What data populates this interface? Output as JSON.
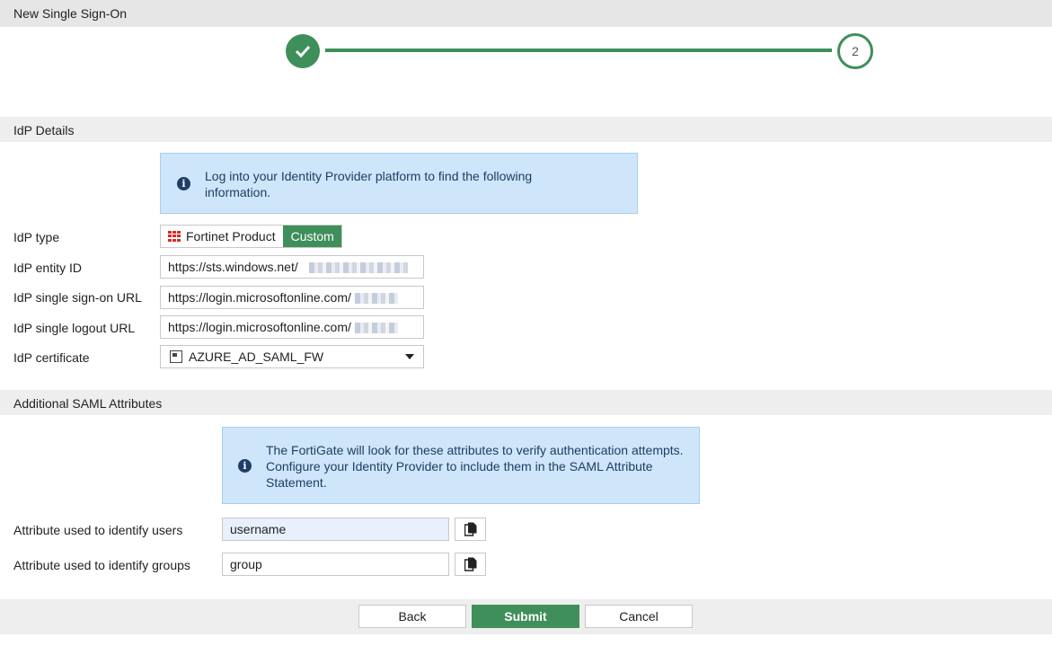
{
  "window": {
    "title": "New Single Sign-On"
  },
  "stepper": {
    "step2_label": "2"
  },
  "idp_section": {
    "heading": "IdP Details",
    "info": "Log into your Identity Provider platform to find the following information.",
    "type_label": "IdP type",
    "type_options": [
      "Fortinet Product",
      "Custom"
    ],
    "type_selected": "Custom",
    "entity_id_label": "IdP entity ID",
    "entity_id_value": "https://sts.windows.net/",
    "sso_url_label": "IdP single sign-on URL",
    "sso_url_value": "https://login.microsoftonline.com/",
    "logout_url_label": "IdP single logout URL",
    "logout_url_value": "https://login.microsoftonline.com/",
    "cert_label": "IdP certificate",
    "cert_value": "AZURE_AD_SAML_FW"
  },
  "saml_section": {
    "heading": "Additional SAML Attributes",
    "info": "The FortiGate will look for these attributes to verify authentication attempts. Configure your Identity Provider to include them in the SAML Attribute Statement.",
    "users_label": "Attribute used to identify users",
    "users_value": "username",
    "groups_label": "Attribute used to identify groups",
    "groups_value": "group"
  },
  "footer": {
    "back": "Back",
    "submit": "Submit",
    "cancel": "Cancel"
  },
  "colors": {
    "accent": "#3f8f5a",
    "info_bg": "#cfe5f9",
    "info_text": "#1e3d66"
  }
}
